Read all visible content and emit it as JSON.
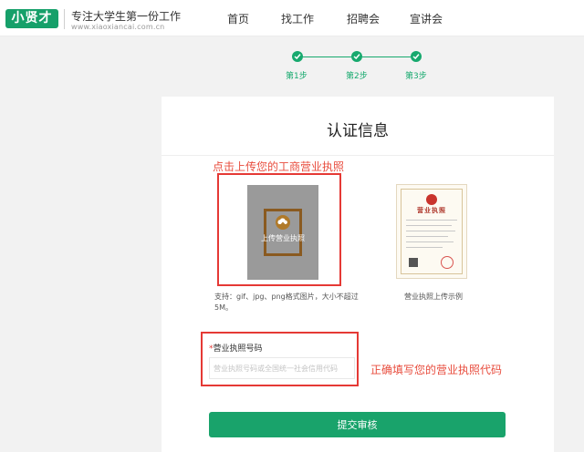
{
  "header": {
    "logo_text": "小贤才",
    "slogan": "专注大学生第一份工作",
    "url": "www.xiaoxiancai.com.cn",
    "nav": [
      {
        "label": "首页"
      },
      {
        "label": "找工作"
      },
      {
        "label": "招聘会"
      },
      {
        "label": "宣讲会"
      }
    ]
  },
  "steps": [
    {
      "label": "第1步"
    },
    {
      "label": "第2步"
    },
    {
      "label": "第3步"
    }
  ],
  "card": {
    "title": "认证信息",
    "upload_hint": "点击上传您的工商营业执照",
    "upload_button_text": "上传营业执照",
    "support_text": "支持：gif、jpg、png格式图片，大小不超过5M。",
    "sample_title": "营业执照",
    "sample_caption": "营业执照上传示例",
    "license_field": {
      "required_mark": "*",
      "label": "营业执照号码",
      "placeholder": "营业执照号码或全国统一社会信用代码",
      "value": ""
    },
    "license_hint": "正确填写您的营业执照代码",
    "submit_label": "提交审核"
  },
  "colors": {
    "brand": "#16a06a",
    "annotation_red": "#e53935"
  }
}
